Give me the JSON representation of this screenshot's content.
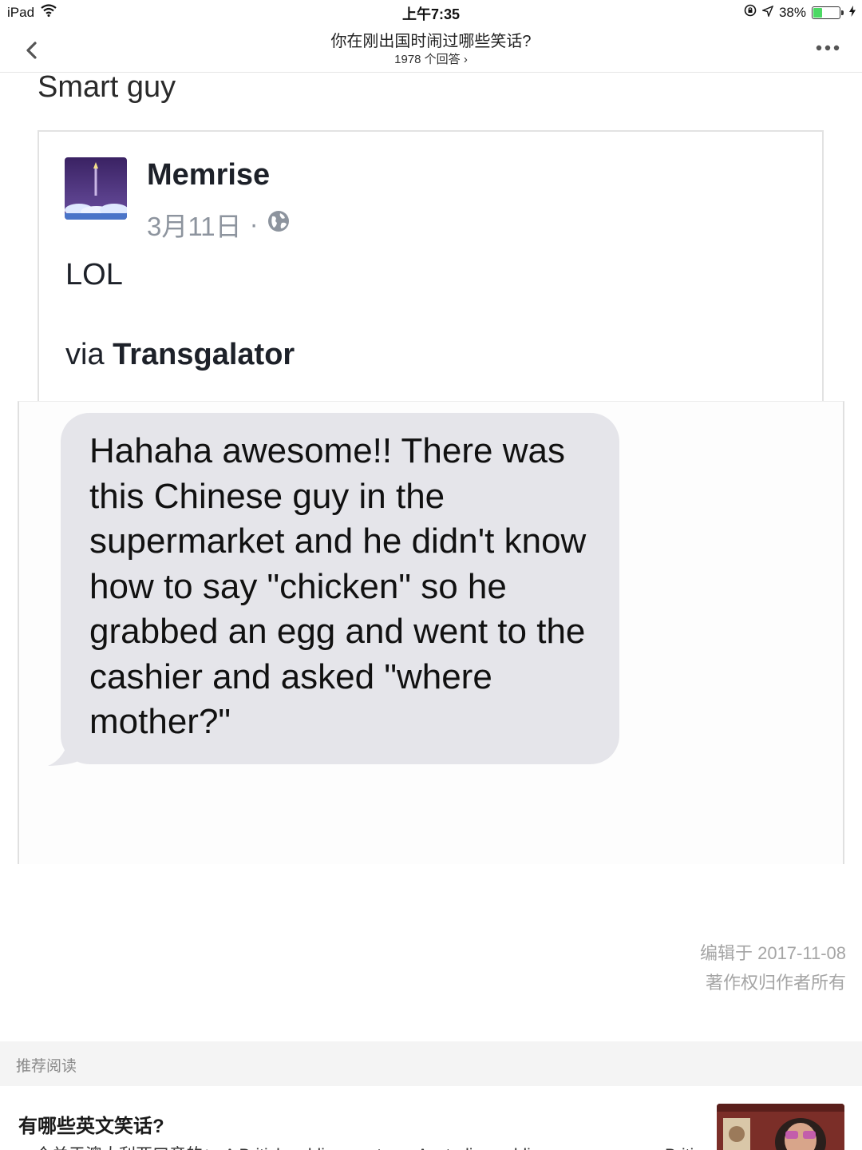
{
  "status_bar": {
    "device": "iPad",
    "time": "上午7:35",
    "battery": "38%",
    "battery_level": 0.38
  },
  "nav": {
    "title": "你在刚出国时闹过哪些笑话?",
    "answer_count": "1978 个回答 ›"
  },
  "answer": {
    "intro": "Smart guy"
  },
  "post": {
    "author": "Memrise",
    "date": "3月11日",
    "separator": "·",
    "body_line1": "LOL",
    "via_prefix": "via ",
    "via_source": "Transgalator"
  },
  "sms": {
    "message": "Hahaha awesome!! There was this Chinese guy in the supermarket and he didn't know how to say \"chicken\" so he grabbed an egg and went to the cashier and asked \"where mother?\""
  },
  "footer": {
    "edited": "编辑于 2017-11-08",
    "copyright": "著作权归作者所有"
  },
  "recommend": {
    "label": "推荐阅读",
    "items": [
      {
        "title": "有哪些英文笑话?",
        "excerpt": "一个关于澳大利亚口音的：  A British soldier meets an Australian soldier on a war zone. British"
      }
    ]
  },
  "colors": {
    "bubble": "#e5e5ea",
    "battery_fill": "#4cd964",
    "meta_gray": "#8d949e"
  },
  "icons": [
    "wifi-icon",
    "location-lock-icon",
    "location-arrow-icon",
    "battery-icon",
    "charging-icon",
    "back-chevron-icon",
    "more-dots-icon",
    "globe-icon"
  ]
}
